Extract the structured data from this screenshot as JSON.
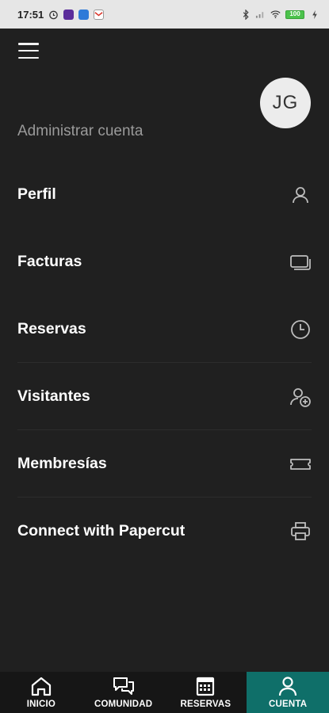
{
  "status_bar": {
    "time": "17:51",
    "battery": "100"
  },
  "account": {
    "avatar_initials": "JG",
    "section_title": "Administrar cuenta"
  },
  "menu": {
    "items": [
      {
        "label": "Perfil",
        "icon": "user-icon"
      },
      {
        "label": "Facturas",
        "icon": "cards-icon"
      },
      {
        "label": "Reservas",
        "icon": "clock-icon"
      },
      {
        "label": "Visitantes",
        "icon": "add-user-icon"
      },
      {
        "label": "Membresías",
        "icon": "ticket-icon"
      },
      {
        "label": "Connect with Papercut",
        "icon": "printer-icon"
      }
    ]
  },
  "bottom_nav": {
    "active": "CUENTA",
    "active_color": "#0f6f69",
    "items": [
      {
        "label": "INICIO",
        "icon": "home-icon"
      },
      {
        "label": "COMUNIDAD",
        "icon": "chat-icon"
      },
      {
        "label": "RESERVAS",
        "icon": "calendar-icon"
      },
      {
        "label": "CUENTA",
        "icon": "user-icon"
      }
    ]
  },
  "colors": {
    "background": "#202020",
    "text": "#ffffff",
    "muted_text": "#9a9a9a",
    "icon": "#bdbdbd"
  }
}
